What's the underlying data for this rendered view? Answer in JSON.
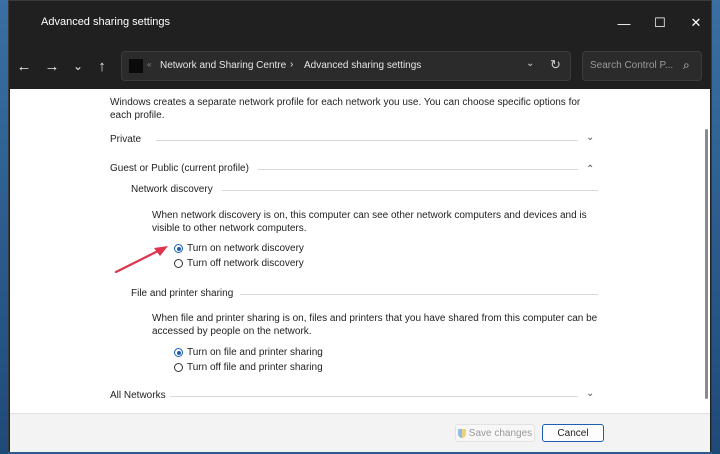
{
  "window": {
    "title": "Advanced sharing settings",
    "controls": {
      "minimize": "—",
      "maximize": "☐",
      "close": "✕"
    }
  },
  "nav": {
    "back": "←",
    "forward": "→",
    "recent": "⌄",
    "up": "↑",
    "address_sep": "«",
    "breadcrumb": [
      "Network and Sharing Centre",
      "Advanced sharing settings"
    ],
    "breadcrumb_sep": "›",
    "address_dropdown": "⌄",
    "refresh": "↻",
    "search_placeholder": "Search Control P...",
    "search_icon": "⌕"
  },
  "content": {
    "intro": "Windows creates a separate network profile for each network you use. You can choose specific options for each profile.",
    "private_label": "Private",
    "guest_label": "Guest or Public (current profile)",
    "network_discovery": {
      "title": "Network discovery",
      "description": "When network discovery is on, this computer can see other network computers and devices and is visible to other network computers.",
      "options": [
        "Turn on network discovery",
        "Turn off network discovery"
      ],
      "selected": 0
    },
    "file_printer_sharing": {
      "title": "File and printer sharing",
      "description": "When file and printer sharing is on, files and printers that you have shared from this computer can be accessed by people on the network.",
      "options": [
        "Turn on file and printer sharing",
        "Turn off file and printer sharing"
      ],
      "selected": 0
    },
    "all_networks_label": "All Networks",
    "chevron_down": "⌄",
    "chevron_up": "⌃"
  },
  "footer": {
    "save_label": "Save changes",
    "cancel_label": "Cancel"
  },
  "colors": {
    "accent": "#1a5fb4",
    "annotation_arrow": "#e0344e",
    "titlebar": "#202020"
  }
}
